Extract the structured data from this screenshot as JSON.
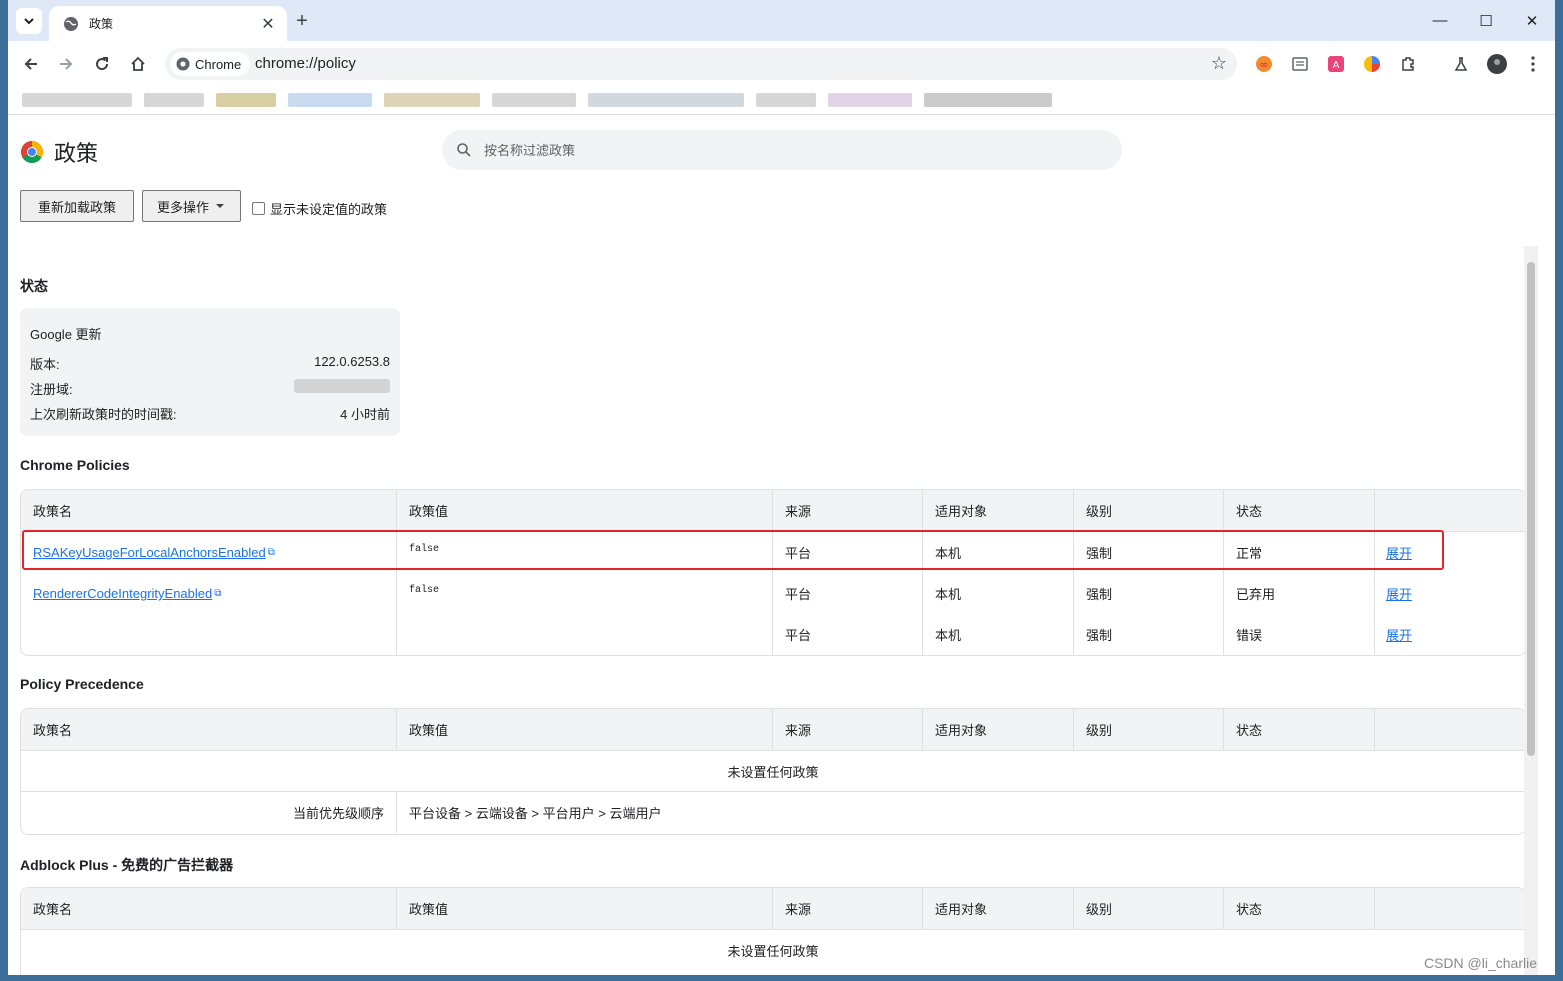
{
  "tab": {
    "title": "政策",
    "close": "✕",
    "new_tab": "+"
  },
  "window_controls": {
    "minimize": "—",
    "maximize": "☐",
    "close": "✕"
  },
  "omnibox": {
    "chip_label": "Chrome",
    "url": "chrome://policy"
  },
  "page": {
    "title": "政策",
    "search_placeholder": "按名称过滤政策",
    "reload_button": "重新加载政策",
    "more_actions_button": "更多操作",
    "show_unset_label": "显示未设定值的政策"
  },
  "status": {
    "heading": "状态",
    "box_title": "Google 更新",
    "version_label": "版本:",
    "version_value": "122.0.6253.8",
    "domain_label": "注册域:",
    "timestamp_label": "上次刷新政策时的时间戳:",
    "timestamp_value": "4 小时前"
  },
  "columns": [
    "政策名",
    "政策值",
    "来源",
    "适用对象",
    "级别",
    "状态"
  ],
  "chrome_policies": {
    "heading": "Chrome Policies",
    "rows": [
      {
        "name": "RSAKeyUsageForLocalAnchorsEnabled",
        "value": "false",
        "source": "平台",
        "scope": "本机",
        "level": "强制",
        "status": "正常",
        "action": "展开"
      },
      {
        "name": "RendererCodeIntegrityEnabled",
        "value": "false",
        "source": "平台",
        "scope": "本机",
        "level": "强制",
        "status": "已弃用",
        "action": "展开"
      },
      {
        "name": "",
        "value": "",
        "source": "平台",
        "scope": "本机",
        "level": "强制",
        "status": "错误",
        "action": "展开"
      }
    ]
  },
  "precedence": {
    "heading": "Policy Precedence",
    "empty": "未设置任何政策",
    "order_label": "当前优先级顺序",
    "order_value": "平台设备 > 云端设备 > 平台用户 > 云端用户"
  },
  "adblock": {
    "heading": "Adblock Plus - 免费的广告拦截器",
    "empty": "未设置任何政策"
  },
  "watermark": "CSDN @li_charlie"
}
